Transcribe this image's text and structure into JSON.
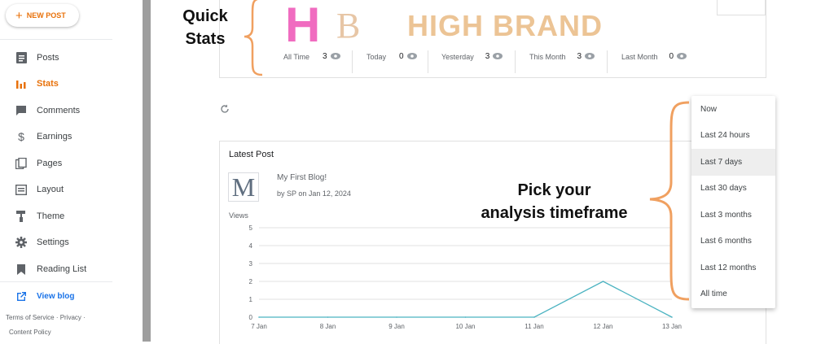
{
  "sidebar": {
    "new_post_label": "NEW POST",
    "items": [
      {
        "label": "Posts",
        "icon": "document-icon"
      },
      {
        "label": "Stats",
        "icon": "bar-chart-icon"
      },
      {
        "label": "Comments",
        "icon": "comment-icon"
      },
      {
        "label": "Earnings",
        "icon": "dollar-icon"
      },
      {
        "label": "Pages",
        "icon": "pages-icon"
      },
      {
        "label": "Layout",
        "icon": "layout-icon"
      },
      {
        "label": "Theme",
        "icon": "paint-roller-icon"
      },
      {
        "label": "Settings",
        "icon": "gear-icon"
      },
      {
        "label": "Reading List",
        "icon": "bookmark-icon"
      }
    ],
    "view_blog_label": "View blog",
    "footer": {
      "terms": "Terms of Service",
      "privacy": "Privacy",
      "content_policy": "Content Policy"
    }
  },
  "overlay": {
    "brand_letters_h": "H",
    "brand_letters_b": "B",
    "brand_name": "HIGH BRAND",
    "quick_stats": [
      "Quick",
      "Stats"
    ],
    "pick_timeframe": [
      "Pick your",
      "analysis timeframe"
    ]
  },
  "stats": [
    {
      "label": "All Time",
      "value": "3"
    },
    {
      "label": "Today",
      "value": "0"
    },
    {
      "label": "Yesterday",
      "value": "3"
    },
    {
      "label": "This Month",
      "value": "3"
    },
    {
      "label": "Last Month",
      "value": "0"
    }
  ],
  "latest_post": {
    "heading": "Latest Post",
    "logo_letter": "M",
    "title": "My First Blog!",
    "meta": "by SP on Jan 12, 2024"
  },
  "chart_data": {
    "type": "line",
    "ylabel": "Views",
    "x": [
      "7 Jan",
      "8 Jan",
      "9 Jan",
      "10 Jan",
      "11 Jan",
      "12 Jan",
      "13 Jan"
    ],
    "series": [
      {
        "values": [
          0,
          0,
          0,
          0,
          0,
          2,
          0
        ]
      }
    ],
    "ylim": [
      0,
      5
    ],
    "yticks": [
      0,
      1,
      2,
      3,
      4,
      5
    ],
    "grid": true,
    "line_color": "#4bb3c1"
  },
  "timeframe_dropdown": {
    "options": [
      "Now",
      "Last 24 hours",
      "Last 7 days",
      "Last 30 days",
      "Last 3 months",
      "Last 6 months",
      "Last 12 months",
      "All time"
    ],
    "selected": "Last 7 days"
  },
  "colors": {
    "accent": "#e8710a",
    "link": "#1a73e8",
    "annotation_brace": "#f0a060"
  }
}
